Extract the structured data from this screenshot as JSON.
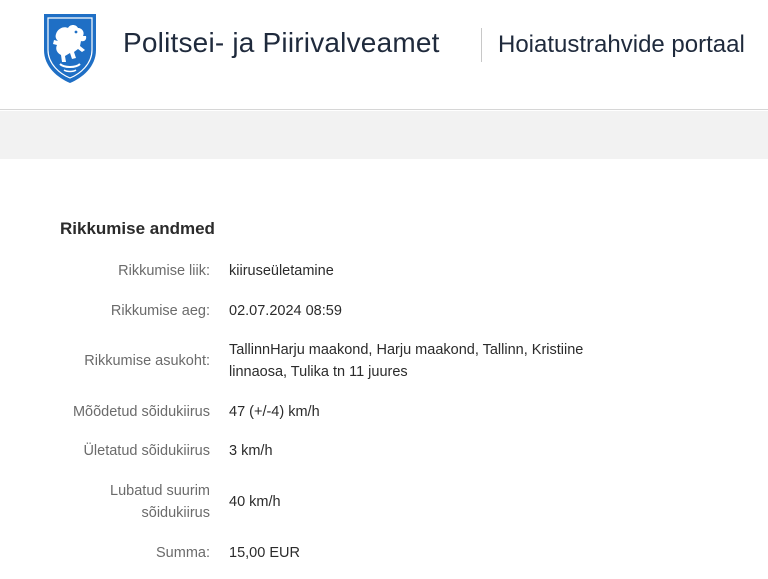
{
  "header": {
    "org_name": "Politsei- ja Piirivalveamet",
    "portal_name": "Hoiatustrahvide portaal",
    "logo_icon": "police-coat-of-arms-lion-icon",
    "brand_color": "#1f6fc5"
  },
  "details": {
    "title": "Rikkumise andmed",
    "rows": [
      {
        "label": "Rikkumise liik:",
        "value": "kiiruseületamine"
      },
      {
        "label": "Rikkumise aeg:",
        "value": "02.07.2024 08:59"
      },
      {
        "label": "Rikkumise asukoht:",
        "value": "TallinnHarju maakond, Harju maakond, Tallinn, Kristiine linnaosa, Tulika tn 11 juures"
      },
      {
        "label": "Mõõdetud sõidukiirus",
        "value": "47 (+/-4) km/h"
      },
      {
        "label": "Ületatud sõidukiirus",
        "value": "3 km/h"
      },
      {
        "label": "Lubatud suurim sõidukiirus",
        "value": "40 km/h"
      },
      {
        "label": "Summa:",
        "value": "15,00 EUR"
      }
    ]
  }
}
